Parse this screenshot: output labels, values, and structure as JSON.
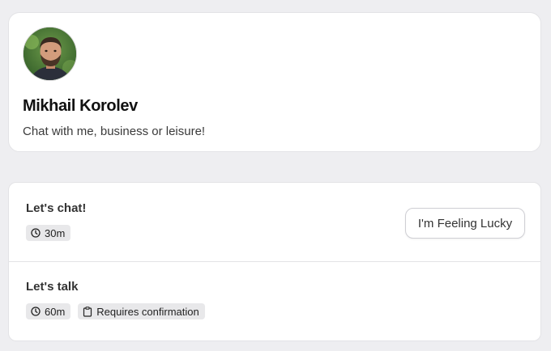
{
  "profile": {
    "name": "Mikhail Korolev",
    "bio": "Chat with me, business or leisure!"
  },
  "events": [
    {
      "title": "Let's chat!",
      "badges": [
        {
          "icon": "clock-icon",
          "label": "30m"
        }
      ],
      "button_label": "I'm Feeling Lucky"
    },
    {
      "title": "Let's talk",
      "badges": [
        {
          "icon": "clock-icon",
          "label": "60m"
        },
        {
          "icon": "clipboard-icon",
          "label": "Requires confirmation"
        }
      ]
    }
  ],
  "colors": {
    "page_background": "#eeeef1",
    "card_background": "#ffffff",
    "badge_background": "#e8e8ea",
    "border": "#e3e3e6"
  }
}
